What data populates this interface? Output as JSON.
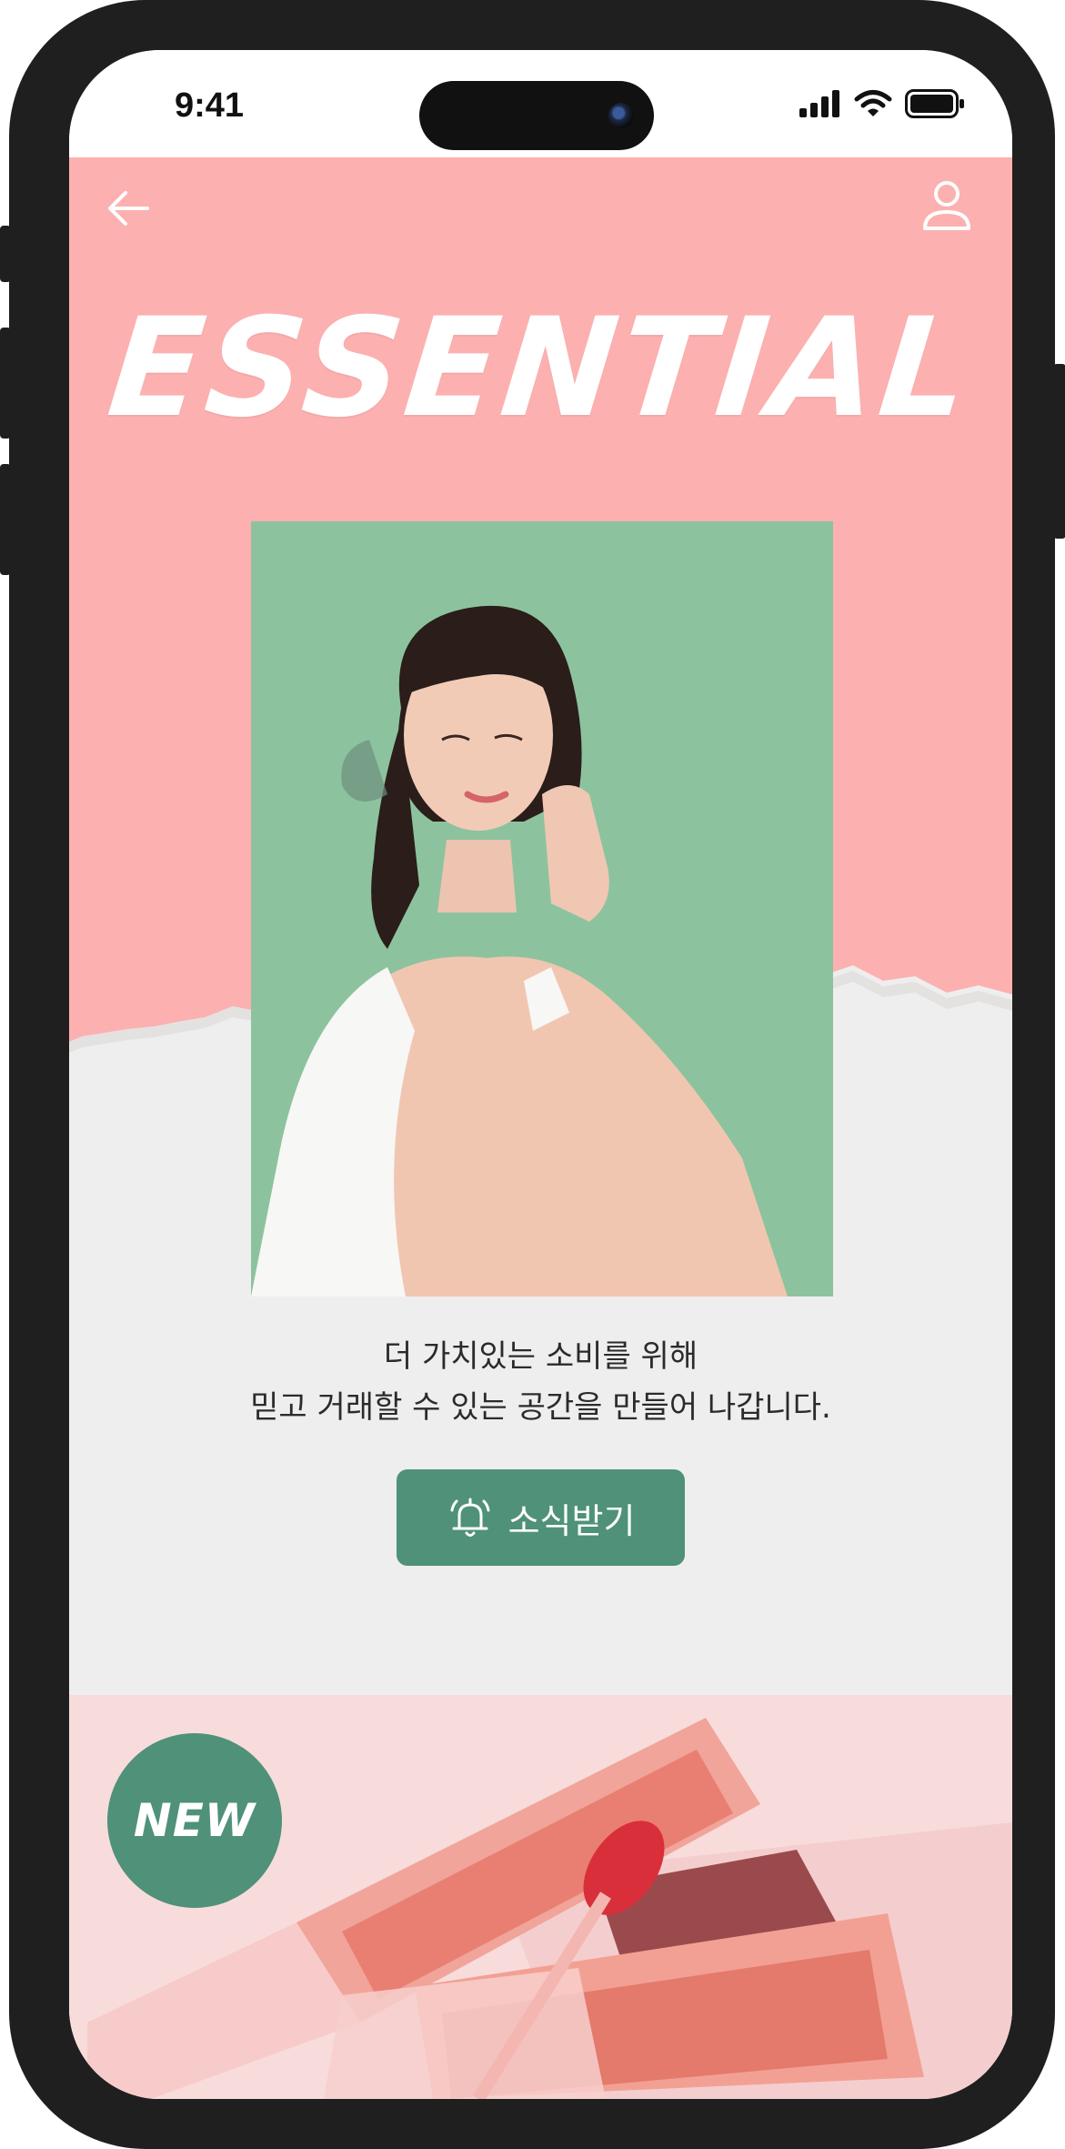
{
  "status_bar": {
    "time": "9:41",
    "icons": [
      "signal-icon",
      "wifi-icon",
      "battery-icon"
    ]
  },
  "nav": {
    "back_icon": "arrow-left-icon",
    "profile_icon": "user-icon"
  },
  "hero": {
    "brand_title": "ESSENTIAL",
    "caption_line1": "더 가치있는 소비를 위해",
    "caption_line2": "믿고 거래할 수 있는 공간을 만들어 나갑니다.",
    "notify_button": {
      "icon": "bell-icon",
      "label": "소식받기"
    }
  },
  "new_section": {
    "badge": "NEW"
  },
  "colors": {
    "pink": "#fcb0b0",
    "light_gray": "#efeeee",
    "green": "#4f9179",
    "photo_bg": "#8cc39e",
    "product_bg": "#f8dcdc"
  }
}
